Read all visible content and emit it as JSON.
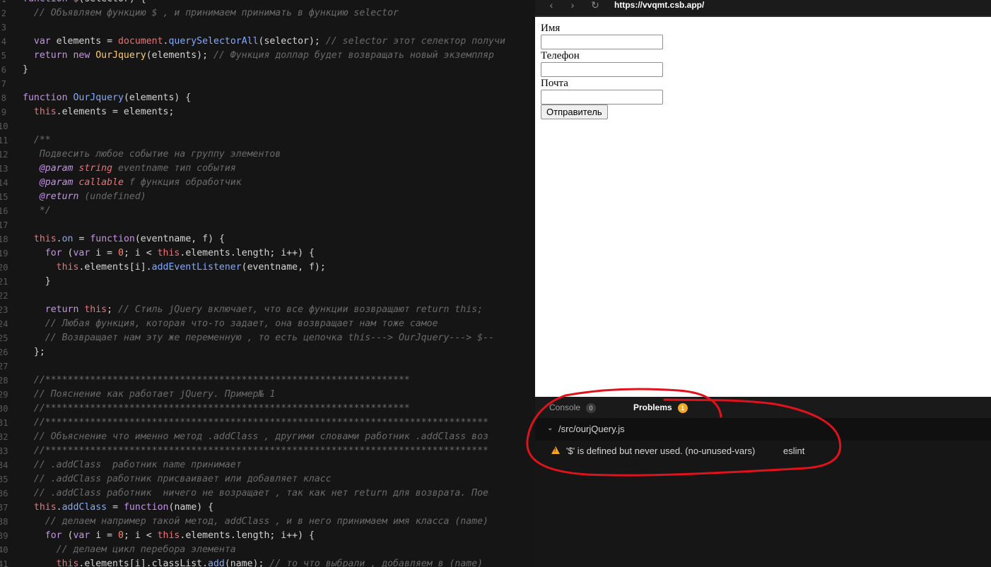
{
  "editor": {
    "lines": [
      {
        "n": "1",
        "t": [
          [
            "function ",
            "kw"
          ],
          [
            "$",
            "var"
          ],
          [
            "(selector) {",
            "pl"
          ]
        ]
      },
      {
        "n": "2",
        "t": [
          [
            "  // Объявляем функцию $ , и принимаем принимать в функцию selector",
            "cm"
          ]
        ]
      },
      {
        "n": "3",
        "t": [
          [
            "",
            "pl"
          ]
        ]
      },
      {
        "n": "4",
        "t": [
          [
            "  ",
            "pl"
          ],
          [
            "var ",
            "kw"
          ],
          [
            "elements = ",
            "pl"
          ],
          [
            "document",
            "var"
          ],
          [
            ".",
            "pl"
          ],
          [
            "querySelectorAll",
            "fn"
          ],
          [
            "(selector); ",
            "pl"
          ],
          [
            "// selector этот селектор получи",
            "cm"
          ]
        ]
      },
      {
        "n": "5",
        "t": [
          [
            "  ",
            "pl"
          ],
          [
            "return new ",
            "kw"
          ],
          [
            "OurJquery",
            "cls"
          ],
          [
            "(elements); ",
            "pl"
          ],
          [
            "// Функция доллар будет возвращать новый экземпляр",
            "cm"
          ]
        ]
      },
      {
        "n": "6",
        "t": [
          [
            "}",
            "pl"
          ]
        ]
      },
      {
        "n": "7",
        "t": [
          [
            "",
            "pl"
          ]
        ]
      },
      {
        "n": "8",
        "t": [
          [
            "function ",
            "kw"
          ],
          [
            "OurJquery",
            "fn"
          ],
          [
            "(elements) {",
            "pl"
          ]
        ]
      },
      {
        "n": "9",
        "t": [
          [
            "  ",
            "pl"
          ],
          [
            "this",
            "this"
          ],
          [
            ".elements = elements;",
            "pl"
          ]
        ]
      },
      {
        "n": "10",
        "t": [
          [
            "",
            "pl"
          ]
        ]
      },
      {
        "n": "11",
        "t": [
          [
            "  /**",
            "doc"
          ]
        ]
      },
      {
        "n": "12",
        "t": [
          [
            "   Подвесить любое событие на группу элементов",
            "doc"
          ]
        ]
      },
      {
        "n": "13",
        "t": [
          [
            "   ",
            "doc"
          ],
          [
            "@param ",
            "tag"
          ],
          [
            "string ",
            "typ"
          ],
          [
            "eventname тип события",
            "doc"
          ]
        ]
      },
      {
        "n": "14",
        "t": [
          [
            "   ",
            "doc"
          ],
          [
            "@param ",
            "tag"
          ],
          [
            "callable ",
            "typ"
          ],
          [
            "f функция обработчик",
            "doc"
          ]
        ]
      },
      {
        "n": "15",
        "t": [
          [
            "   ",
            "doc"
          ],
          [
            "@return ",
            "tag"
          ],
          [
            "(undefined)",
            "doc"
          ]
        ]
      },
      {
        "n": "16",
        "t": [
          [
            "   */",
            "doc"
          ]
        ]
      },
      {
        "n": "17",
        "t": [
          [
            "",
            "pl"
          ]
        ]
      },
      {
        "n": "18",
        "t": [
          [
            "  ",
            "pl"
          ],
          [
            "this",
            "this"
          ],
          [
            ".",
            "pl"
          ],
          [
            "on",
            "fn"
          ],
          [
            " = ",
            "pl"
          ],
          [
            "function",
            "kw"
          ],
          [
            "(eventname, f) {",
            "pl"
          ]
        ]
      },
      {
        "n": "19",
        "t": [
          [
            "    ",
            "pl"
          ],
          [
            "for ",
            "kw"
          ],
          [
            "(",
            "pl"
          ],
          [
            "var ",
            "kw"
          ],
          [
            "i = ",
            "pl"
          ],
          [
            "0",
            "num"
          ],
          [
            "; i < ",
            "pl"
          ],
          [
            "this",
            "this"
          ],
          [
            ".elements.length; i++) {",
            "pl"
          ]
        ]
      },
      {
        "n": "20",
        "t": [
          [
            "      ",
            "pl"
          ],
          [
            "this",
            "this"
          ],
          [
            ".elements[i].",
            "pl"
          ],
          [
            "addEventListener",
            "fn"
          ],
          [
            "(eventname, f);",
            "pl"
          ]
        ]
      },
      {
        "n": "21",
        "t": [
          [
            "    }",
            "pl"
          ]
        ]
      },
      {
        "n": "22",
        "t": [
          [
            "",
            "pl"
          ]
        ]
      },
      {
        "n": "23",
        "t": [
          [
            "    ",
            "pl"
          ],
          [
            "return ",
            "kw"
          ],
          [
            "this",
            "this"
          ],
          [
            "; ",
            "pl"
          ],
          [
            "// Стиль jQuery включает, что все функции возвращают return this;",
            "cm"
          ]
        ]
      },
      {
        "n": "24",
        "t": [
          [
            "    // Любая функция, которая что-то задает, она возвращает нам тоже самое",
            "cm"
          ]
        ]
      },
      {
        "n": "25",
        "t": [
          [
            "    // Возвращает нам эту же переменную , то есть цепочка this---> OurJquery---> $--",
            "cm"
          ]
        ]
      },
      {
        "n": "26",
        "t": [
          [
            "  };",
            "pl"
          ]
        ]
      },
      {
        "n": "27",
        "t": [
          [
            "",
            "pl"
          ]
        ]
      },
      {
        "n": "28",
        "t": [
          [
            "  //*****************************************************************",
            "cm"
          ]
        ]
      },
      {
        "n": "29",
        "t": [
          [
            "  // Пояснение как работает jQuery. Пример№ 1",
            "cm"
          ]
        ]
      },
      {
        "n": "30",
        "t": [
          [
            "  //*****************************************************************",
            "cm"
          ]
        ]
      },
      {
        "n": "31",
        "t": [
          [
            "  //*******************************************************************************",
            "cm"
          ]
        ]
      },
      {
        "n": "32",
        "t": [
          [
            "  // Объяснение что именно метод .addClass , другими словами работник .addClass воз",
            "cm"
          ]
        ]
      },
      {
        "n": "33",
        "t": [
          [
            "  //*******************************************************************************",
            "cm"
          ]
        ]
      },
      {
        "n": "34",
        "t": [
          [
            "  // .addClass  работник name принимает",
            "cm"
          ]
        ]
      },
      {
        "n": "35",
        "t": [
          [
            "  // .addClass работник присваивает или добавляет класс",
            "cm"
          ]
        ]
      },
      {
        "n": "36",
        "t": [
          [
            "  // .addClass работник  ничего не возращает , так как нет return для возврата. Пое",
            "cm"
          ]
        ]
      },
      {
        "n": "37",
        "t": [
          [
            "  ",
            "pl"
          ],
          [
            "this",
            "this"
          ],
          [
            ".",
            "pl"
          ],
          [
            "addClass",
            "fn"
          ],
          [
            " = ",
            "pl"
          ],
          [
            "function",
            "kw"
          ],
          [
            "(name) {",
            "pl"
          ]
        ]
      },
      {
        "n": "38",
        "t": [
          [
            "    // делаем например такой метод, addClass , и в него принимаем имя класса (name)",
            "cm"
          ]
        ]
      },
      {
        "n": "39",
        "t": [
          [
            "    ",
            "pl"
          ],
          [
            "for ",
            "kw"
          ],
          [
            "(",
            "pl"
          ],
          [
            "var ",
            "kw"
          ],
          [
            "i = ",
            "pl"
          ],
          [
            "0",
            "num"
          ],
          [
            "; i < ",
            "pl"
          ],
          [
            "this",
            "this"
          ],
          [
            ".elements.length; i++) {",
            "pl"
          ]
        ]
      },
      {
        "n": "40",
        "t": [
          [
            "      // делаем цикл перебора элемента",
            "cm"
          ]
        ]
      },
      {
        "n": "41",
        "t": [
          [
            "      ",
            "pl"
          ],
          [
            "this",
            "this"
          ],
          [
            ".elements[i].classList.",
            "pl"
          ],
          [
            "add",
            "fn"
          ],
          [
            "(name); ",
            "pl"
          ],
          [
            "// то что выбрали , добавляем в (name)",
            "cm"
          ]
        ]
      }
    ]
  },
  "browser": {
    "back_icon": "‹",
    "forward_icon": "›",
    "reload_icon": "↻",
    "url": "https://vvqmt.csb.app/"
  },
  "form": {
    "name_label": "Имя",
    "phone_label": "Телефон",
    "email_label": "Почта",
    "submit_label": "Отправитель"
  },
  "panel": {
    "tabs": [
      {
        "label": "Console",
        "count": "0"
      },
      {
        "label": "Problems",
        "count": "1"
      }
    ],
    "file_chevron": "⌄",
    "file_path": "/src/ourjQuery.js",
    "problem_message": "'$' is defined but never used. (no-unused-vars)",
    "problem_source": "eslint"
  },
  "colors": {
    "editor_bg": "#151515",
    "annotation_red": "#e0121b",
    "warning": "#f5a623"
  }
}
